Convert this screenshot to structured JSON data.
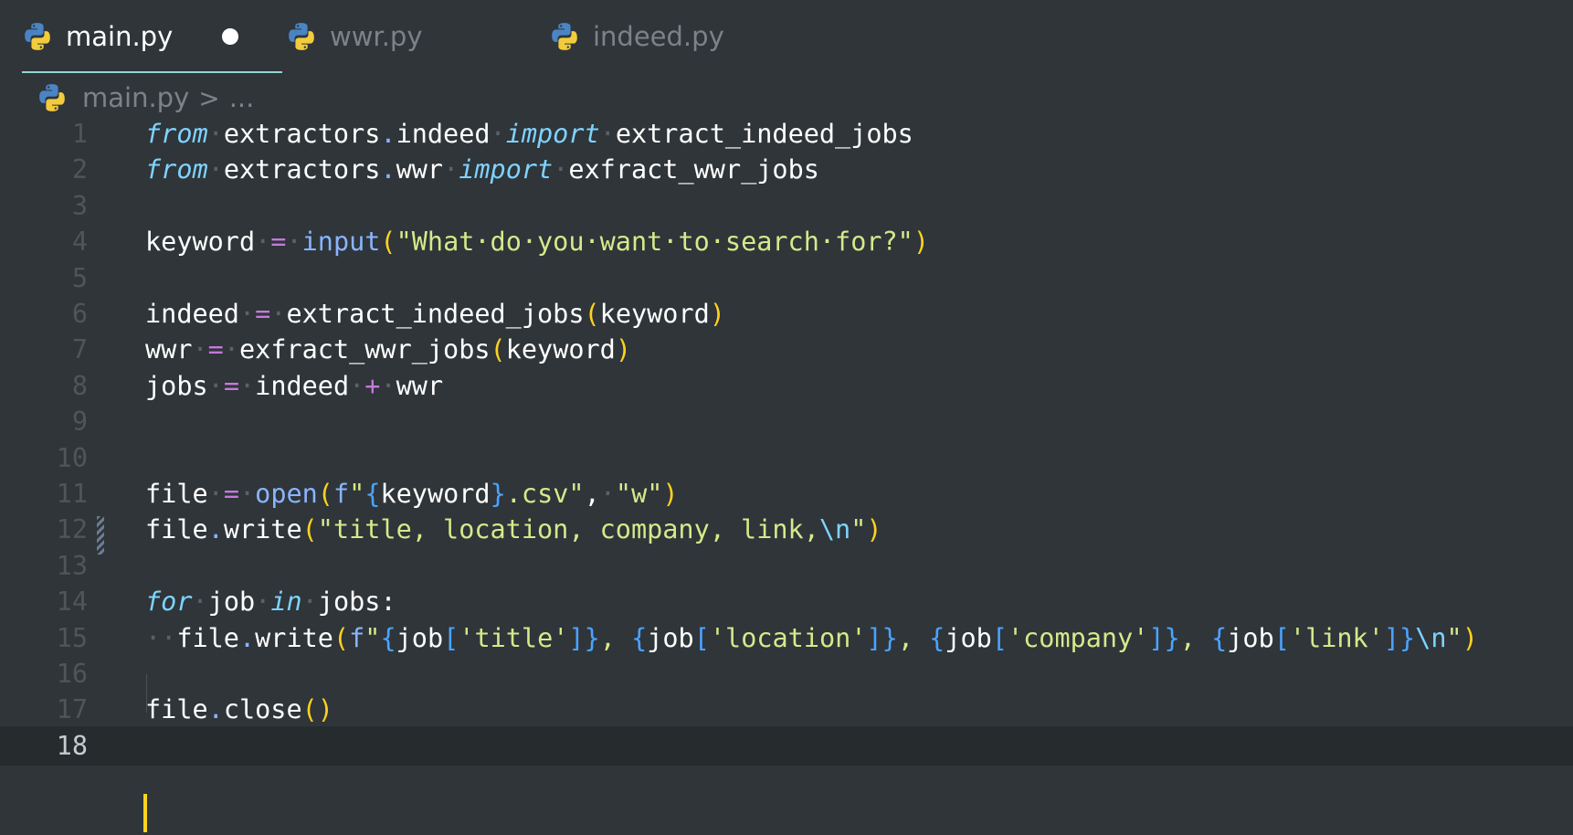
{
  "tabs": [
    {
      "label": "main.py",
      "active": true,
      "dirty": true,
      "icon": "python-icon"
    },
    {
      "label": "wwr.py",
      "active": false,
      "icon": "python-icon"
    },
    {
      "label": "indeed.py",
      "active": false,
      "icon": "python-icon"
    }
  ],
  "breadcrumb": {
    "file": "main.py",
    "separator": ">",
    "rest": "..."
  },
  "colors": {
    "background": "#2f3539",
    "keyword": "#7fd3ff",
    "string": "#d7e88a",
    "operator": "#c678dd",
    "bracket1": "#ffd21f",
    "bracket2": "#d96ad6",
    "bracket3": "#4ba3ff",
    "active_tab_underline": "#8fd6d6"
  },
  "editor": {
    "current_line": 18,
    "line_numbers": [
      "1",
      "2",
      "3",
      "4",
      "5",
      "6",
      "7",
      "8",
      "9",
      "10",
      "11",
      "12",
      "13",
      "14",
      "15",
      "16",
      "17",
      "18"
    ],
    "lines": [
      "from extractors.indeed import extract_indeed_jobs",
      "from extractors.wwr import exfract_wwr_jobs",
      "",
      "keyword = input(\"What do you want to search for?\")",
      "",
      "indeed = extract_indeed_jobs(keyword)",
      "wwr = exfract_wwr_jobs(keyword)",
      "jobs = indeed + wwr",
      "",
      "",
      "file = open(f\"{keyword}.csv\", \"w\")",
      "file.write(\"title, location, company, link,\\n\")",
      "",
      "for job in jobs:",
      "  file.write(f\"{job['title']}, {job['location']}, {job['company']}, {job['link']}\\n\")",
      "",
      "file.close()",
      ""
    ]
  }
}
